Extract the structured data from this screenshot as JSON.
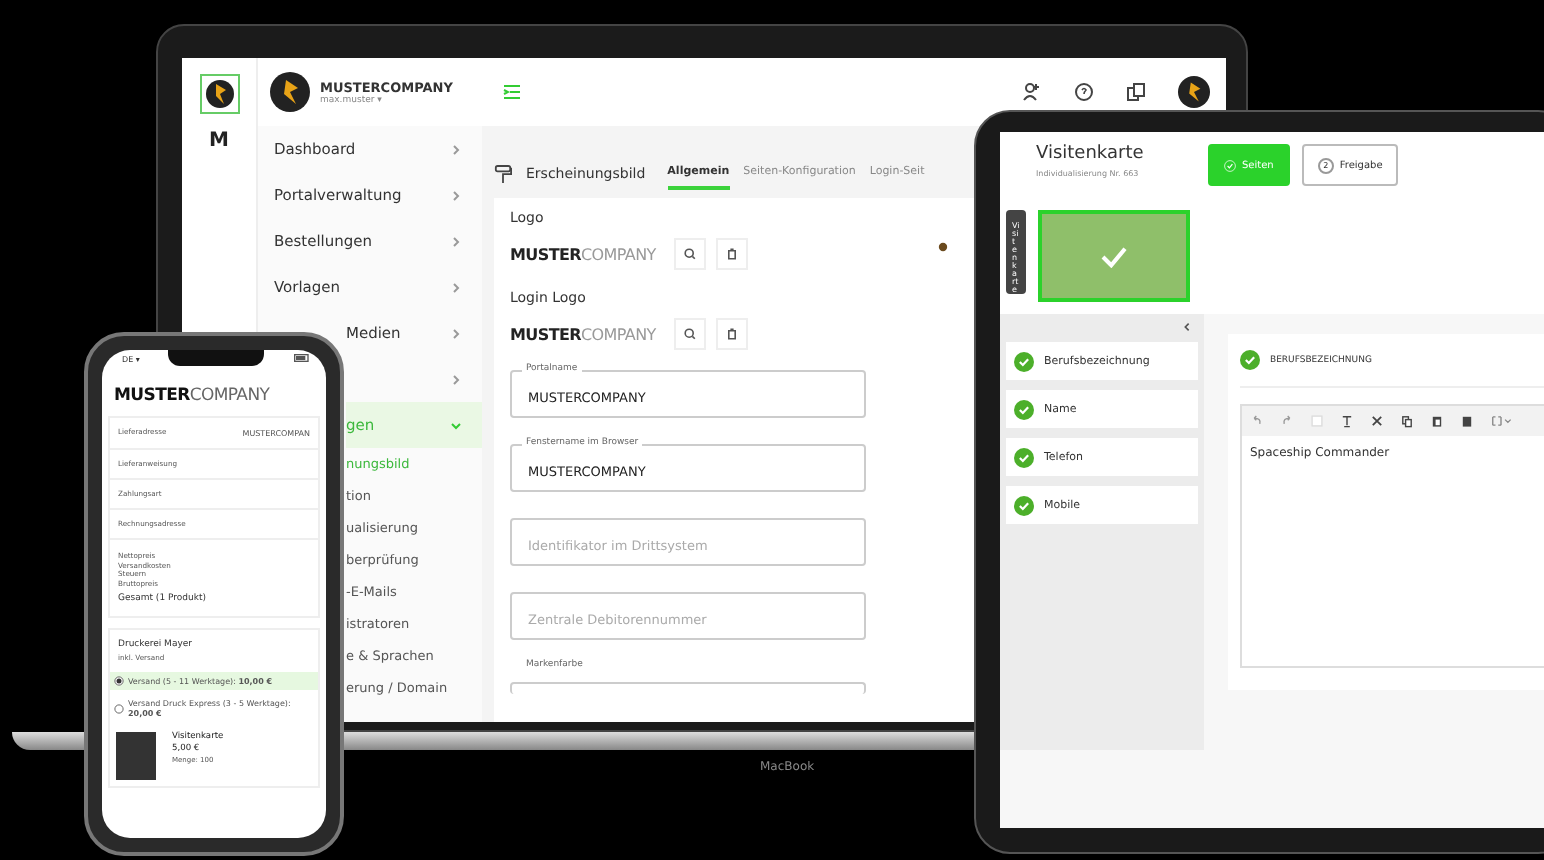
{
  "laptop": {
    "rail_logo": "M",
    "account": {
      "company": "MUSTERCOMPANY",
      "user": "max.muster ▾"
    },
    "sidebar_items": [
      {
        "label": "Dashboard",
        "expanded": false
      },
      {
        "label": "Portalverwaltung",
        "expanded": false
      },
      {
        "label": "Bestellungen",
        "expanded": false
      },
      {
        "label": "Vorlagen",
        "expanded": false
      },
      {
        "label": "Medien",
        "expanded": false
      },
      {
        "expanded": false
      },
      {
        "label": "gen",
        "expanded": true,
        "children": [
          {
            "label": "nungsbild",
            "selected": true
          },
          {
            "label": "tion",
            "selected": false
          },
          {
            "label": "ualisierung",
            "selected": false
          },
          {
            "label": "berprüfung",
            "selected": false
          },
          {
            "label": "-E-Mails",
            "selected": false
          },
          {
            "label": "istratoren",
            "selected": false
          },
          {
            "label": "e & Sprachen",
            "selected": false
          },
          {
            "label": "erung / Domain",
            "selected": false
          }
        ]
      }
    ],
    "section_title": "Erscheinungsbild",
    "tabs": [
      {
        "label": "Allgemein",
        "selected": true
      },
      {
        "label": "Seiten-Konfiguration",
        "selected": false
      },
      {
        "label": "Login-Seit",
        "selected": false
      }
    ],
    "logo_sections": [
      {
        "title": "Logo",
        "logo": "**MUSTER**COMPANY"
      },
      {
        "title": "Login Logo",
        "logo": "**MUSTER**COMPANY"
      }
    ],
    "fields": [
      {
        "label": "Portalname",
        "value": "MUSTERCOMPANY"
      },
      {
        "label": "Fenstername im Browser",
        "value": "MUSTERCOMPANY"
      },
      {
        "placeholder": "Identifikator im Drittsystem"
      },
      {
        "placeholder": "Zentrale Debitorennummer"
      },
      {
        "label": "Markenfarbe"
      }
    ],
    "base_label": "MacBook"
  },
  "tablet": {
    "title": "Visitenkarte",
    "subtitle": "Individualisierung Nr. 663",
    "steps": [
      {
        "label": "Seiten",
        "selected": true
      },
      {
        "number": "2",
        "label": "Freigabe",
        "selected": false
      }
    ],
    "side_tab": "Visitenkarte",
    "fields": [
      {
        "label": "Berufsbezeichnung",
        "done": true
      },
      {
        "label": "Name",
        "done": true
      },
      {
        "label": "Telefon",
        "done": true
      },
      {
        "label": "Mobile",
        "done": true
      }
    ],
    "editor": {
      "heading": "BERUFSBEZEICHNUNG",
      "done": true,
      "text": "Spaceship Commander"
    }
  },
  "phone": {
    "language": "DE ▾",
    "logo": "**MUSTER**COMPANY",
    "rows": [
      {
        "label": "Lieferadresse",
        "value": "MUSTERCOMPAN"
      },
      {
        "label": "Lieferanweisung"
      },
      {
        "label": "Zahlungsart"
      },
      {
        "label": "Rechnungsadresse"
      }
    ],
    "price_lines": [
      "Nettopreis",
      "Versandkosten",
      "Steuern",
      "Bruttopreis"
    ],
    "total": "Gesamt (1 Produkt)",
    "vendor": "Druckerei Mayer",
    "vendor_note": "inkl. Versand",
    "shipping": [
      {
        "label": "Versand (5 - 11 Werktage):",
        "price": "10,00 €",
        "selected": true
      },
      {
        "label": "Versand Druck Express (3 - 5 Werktage):",
        "price": "20,00 €",
        "selected": false
      }
    ],
    "product": {
      "name": "Visitenkarte",
      "price": "5,00 €",
      "quantity": "Menge: 100"
    }
  }
}
